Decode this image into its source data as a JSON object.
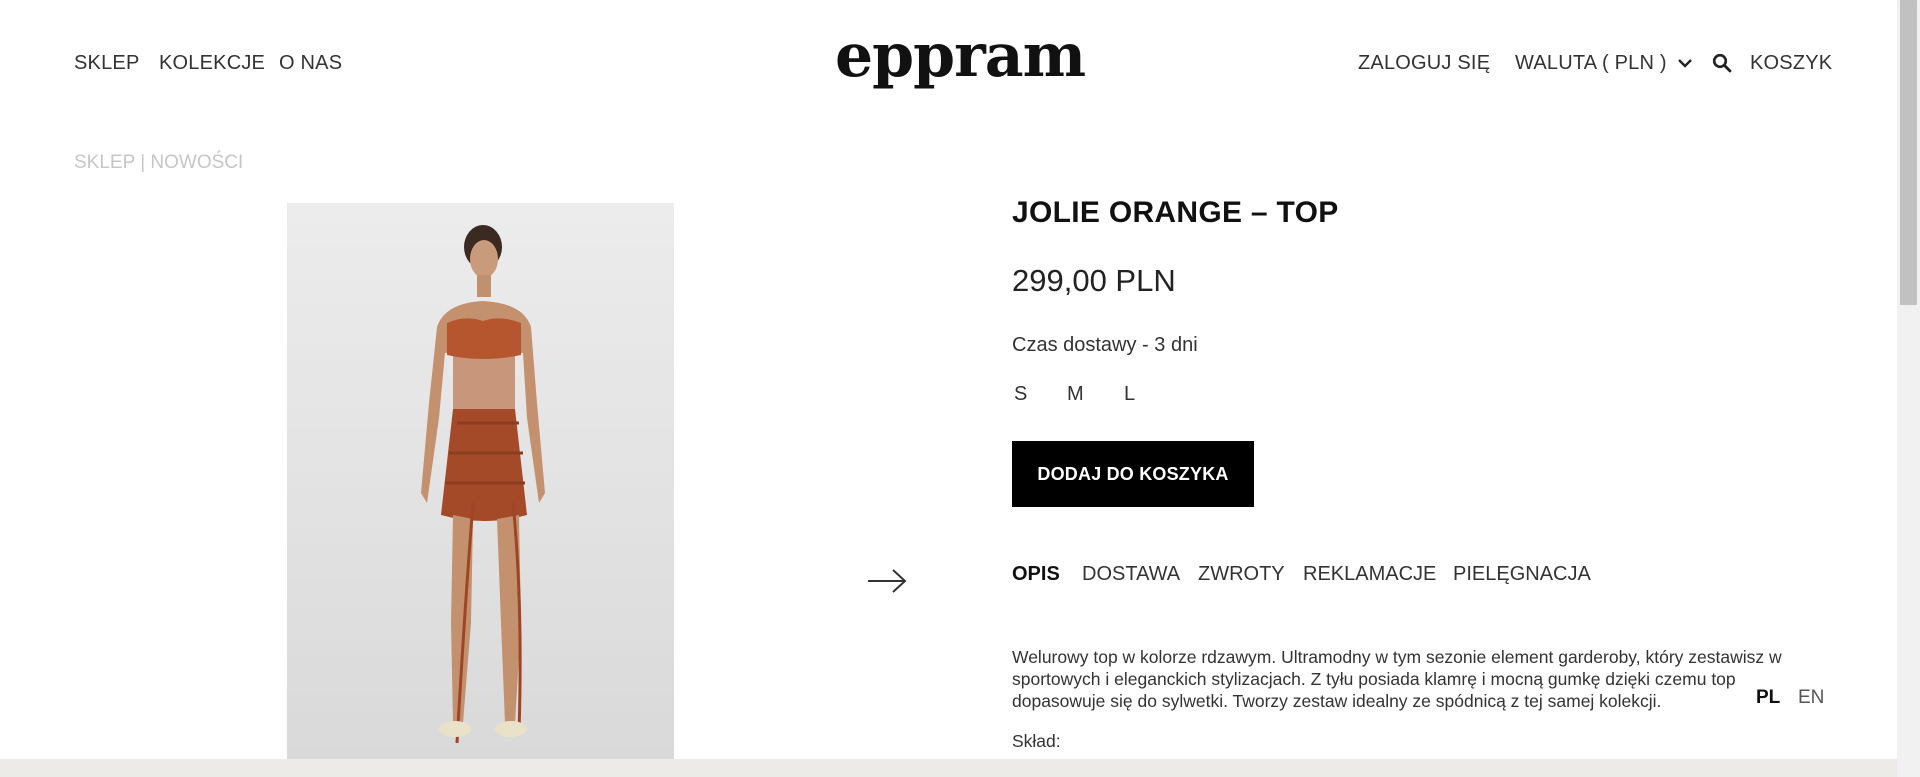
{
  "header": {
    "nav": [
      "SKLEP",
      "KOLEKCJE",
      "O NAS"
    ],
    "logo": "eppram",
    "login": "ZALOGUJ SIĘ",
    "currency": "WALUTA ( PLN )",
    "cart": "KOSZYK"
  },
  "breadcrumb": "SKLEP | NOWOŚCI",
  "product": {
    "title": "JOLIE ORANGE – TOP",
    "price": "299,00 PLN",
    "delivery": "Czas dostawy - 3 dni",
    "sizes": [
      "S",
      "M",
      "L"
    ],
    "add_to_cart": "DODAJ DO KOSZYKA",
    "tabs": [
      "OPIS",
      "DOSTAWA",
      "ZWROTY",
      "REKLAMACJE",
      "PIELĘGNACJA"
    ],
    "active_tab": "OPIS",
    "description_lines": [
      "Welurowy top w kolorze rdzawym. Ultramodny w tym sezonie element garderoby, który zestawisz w",
      "sportowych i eleganckich stylizacjach. Z tyłu posiada klamrę i mocną gumkę dzięki czemu top",
      "dopasowuje się do sylwetki. Tworzy zestaw idealny ze spódnicą z tej samej kolekcji."
    ],
    "composition_label": "Skład:"
  },
  "languages": [
    "PL",
    "EN"
  ],
  "active_language": "PL",
  "icons": {
    "chevron": "chevron-down-icon",
    "search": "search-icon",
    "next": "arrow-right-icon"
  },
  "colors": {
    "accent": "#000000",
    "breadcrumb": "#c6c6c6",
    "garment": "#b5562f"
  }
}
